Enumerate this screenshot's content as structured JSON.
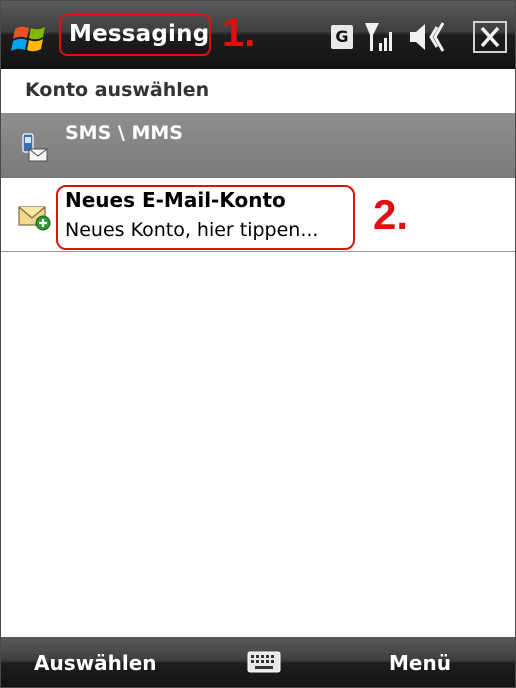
{
  "titlebar": {
    "title": "Messaging",
    "status_icons": [
      "windows-start-icon",
      "network-g-icon",
      "signal-icon",
      "volume-icon",
      "close-icon"
    ],
    "network_badge": "G"
  },
  "annotations": {
    "label_1": "1.",
    "label_2": "2.",
    "color": "#e01010"
  },
  "header": {
    "title": "Konto auswählen"
  },
  "accounts": [
    {
      "title": "SMS \\ MMS",
      "icon": "sms-icon",
      "selected": true
    },
    {
      "title": "Neues E-Mail-Konto",
      "subtitle": "Neues Konto, hier tippen...",
      "icon": "new-email-account-icon"
    }
  ],
  "softkeys": {
    "left": "Auswählen",
    "center_icon": "keyboard-icon",
    "right": "Menü"
  }
}
